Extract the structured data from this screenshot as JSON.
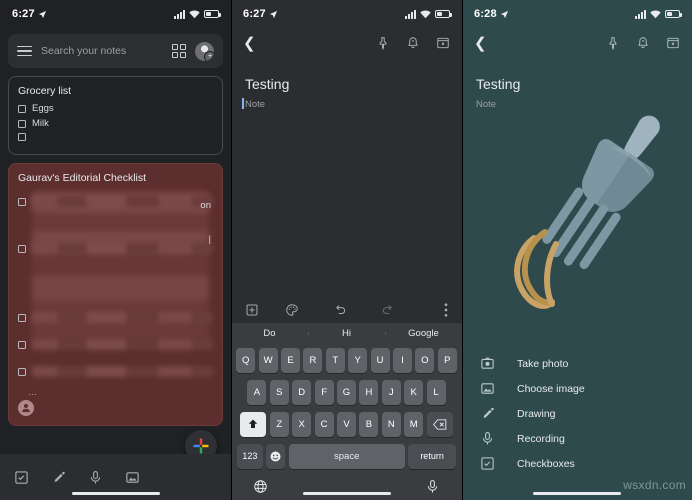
{
  "panel1": {
    "status": {
      "time": "6:27",
      "location_icon": "location-arrow-icon",
      "signal_icon": "signal-bars-icon",
      "wifi_icon": "wifi-icon",
      "battery_icon": "battery-icon"
    },
    "search": {
      "placeholder": "Search your notes",
      "menu_icon": "hamburger-menu-icon",
      "view_icon": "grid-view-icon",
      "avatar_icon": "account-avatar-icon"
    },
    "notes": [
      {
        "title": "Grocery list",
        "type": "checklist",
        "items": [
          "Eggs",
          "Milk",
          ""
        ],
        "color": "#202124"
      },
      {
        "title": "Gaurav's Editorial Checklist",
        "type": "checklist-blurred",
        "items": [
          "",
          "",
          "",
          "",
          ""
        ],
        "overflow": "…",
        "color": "#5d2e2e",
        "collaborator_icon": "collaborator-avatar-icon"
      }
    ],
    "bottom_tools": [
      {
        "icon": "new-checklist-icon",
        "label": "New list"
      },
      {
        "icon": "new-drawing-icon",
        "label": "New drawing"
      },
      {
        "icon": "new-recording-icon",
        "label": "New recording"
      },
      {
        "icon": "new-image-icon",
        "label": "New image note"
      }
    ],
    "fab": {
      "icon": "google-plus-add-icon",
      "label": "New note"
    }
  },
  "panel2": {
    "status": {
      "time": "6:27"
    },
    "editor_bar": {
      "back_icon": "back-arrow-icon",
      "pin_icon": "pin-icon",
      "reminder_icon": "reminder-bell-icon",
      "archive_icon": "archive-icon"
    },
    "title": "Testing",
    "note_placeholder": "Note",
    "note_tools": [
      {
        "icon": "add-box-icon",
        "label": "Add"
      },
      {
        "icon": "palette-icon",
        "label": "Color"
      },
      {
        "icon": "undo-icon",
        "label": "Undo"
      },
      {
        "icon": "redo-icon",
        "label": "Redo"
      },
      {
        "icon": "more-vert-icon",
        "label": "More"
      }
    ],
    "keyboard": {
      "suggestions": [
        "Do",
        "Hi",
        "Google"
      ],
      "row1": [
        "Q",
        "W",
        "E",
        "R",
        "T",
        "Y",
        "U",
        "I",
        "O",
        "P"
      ],
      "row2": [
        "A",
        "S",
        "D",
        "F",
        "G",
        "H",
        "J",
        "K",
        "L"
      ],
      "row3": [
        "Z",
        "X",
        "C",
        "V",
        "B",
        "N",
        "M"
      ],
      "shift_icon": "shift-up-icon",
      "backspace_icon": "backspace-icon",
      "numbers_key": "123",
      "emoji_icon": "emoji-icon",
      "space_key": "space",
      "return_key": "return",
      "globe_icon": "globe-language-icon",
      "mic_icon": "microphone-icon"
    }
  },
  "panel3": {
    "status": {
      "time": "6:28"
    },
    "editor_bar": {
      "back_icon": "back-arrow-icon",
      "pin_icon": "pin-icon",
      "reminder_icon": "reminder-bell-icon",
      "archive_icon": "archive-icon"
    },
    "title": "Testing",
    "note_placeholder": "Note",
    "illustration": "fork-with-spaghetti-illustration",
    "menu": [
      {
        "icon": "camera-icon",
        "label": "Take photo"
      },
      {
        "icon": "image-icon",
        "label": "Choose image"
      },
      {
        "icon": "brush-icon",
        "label": "Drawing"
      },
      {
        "icon": "microphone-icon",
        "label": "Recording"
      },
      {
        "icon": "checkbox-icon",
        "label": "Checkboxes"
      }
    ],
    "watermark": "wsxdn.com"
  },
  "colors": {
    "dark_bg": "#202124",
    "keyboard_bg": "#3a3c3f",
    "maroon_note": "#5d2e2e",
    "teal_note": "#2e4a4d",
    "accent_caret": "#8ab4f8"
  }
}
